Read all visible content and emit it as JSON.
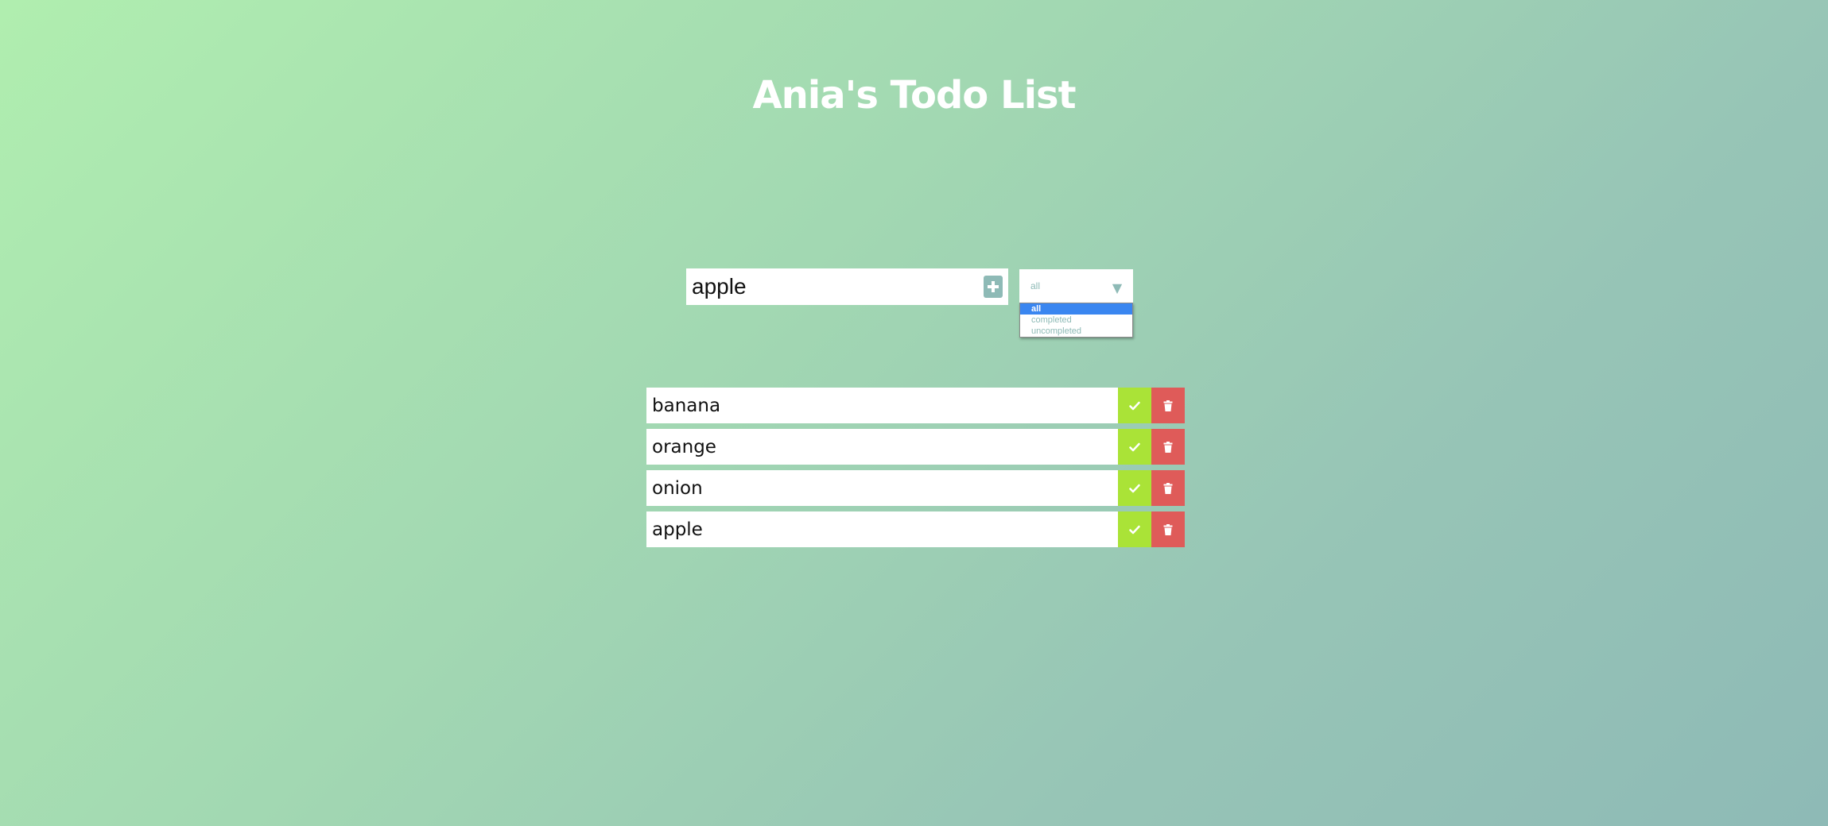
{
  "header": {
    "title": "Ania's Todo List"
  },
  "form": {
    "input_value": "apple",
    "add_icon": "plus-square-icon"
  },
  "filter": {
    "selected": "all",
    "options": [
      "all",
      "completed",
      "uncompleted"
    ]
  },
  "todos": [
    {
      "text": "banana"
    },
    {
      "text": "orange"
    },
    {
      "text": "onion"
    },
    {
      "text": "apple"
    }
  ],
  "icons": {
    "complete": "check-icon",
    "delete": "trash-icon"
  },
  "colors": {
    "accent": "#8ebab6",
    "complete": "#aae337",
    "delete": "#df5b59",
    "selected_option": "#3a86f0"
  }
}
